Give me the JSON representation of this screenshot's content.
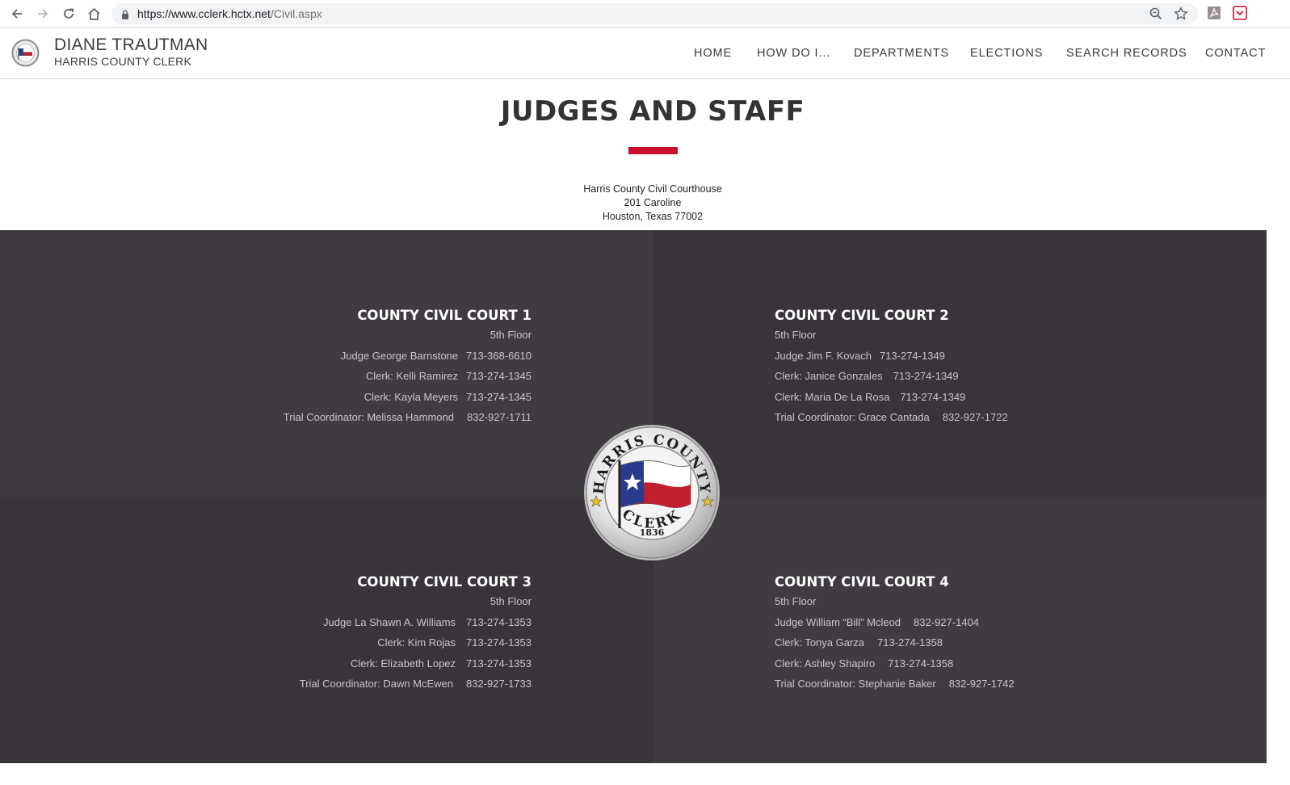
{
  "browser": {
    "url_host": "https://www.cclerk.hctx.net",
    "url_path": "/Civil.aspx"
  },
  "site": {
    "brand_name": "DIANE TRAUTMAN",
    "brand_sub": "HARRIS COUNTY CLERK",
    "nav": [
      "HOME",
      "HOW DO I...",
      "DEPARTMENTS",
      "ELECTIONS",
      "SEARCH RECORDS",
      "CONTACT US"
    ]
  },
  "page": {
    "title": "JUDGES AND STAFF",
    "address": [
      "Harris County Civil Courthouse",
      "201 Caroline",
      "Houston, Texas 77002"
    ],
    "accent_color": "#c8102e"
  },
  "courts": [
    {
      "name": "COUNTY CIVIL COURT 1",
      "floor": "5th Floor",
      "staff": [
        {
          "label": "Judge George Barnstone",
          "phone": "713-368-6610"
        },
        {
          "label": "Clerk: Kelli Ramirez",
          "phone": "713-274-1345"
        },
        {
          "label": "Clerk: Kayla Meyers",
          "phone": "713-274-1345"
        },
        {
          "label": "Trial Coordinator: Melissa Hammond",
          "phone": "832-927-1711"
        }
      ]
    },
    {
      "name": "COUNTY CIVIL COURT 2",
      "floor": "5th Floor",
      "staff": [
        {
          "label": "Judge Jim F. Kovach",
          "phone": "713-274-1349"
        },
        {
          "label": "Clerk: Janice Gonzales",
          "phone": "713-274-1349"
        },
        {
          "label": "Clerk: Maria De La Rosa",
          "phone": "713-274-1349"
        },
        {
          "label": "Trial Coordinator: Grace Cantada",
          "phone": "832-927-1722"
        }
      ]
    },
    {
      "name": "COUNTY CIVIL COURT 3",
      "floor": "5th Floor",
      "staff": [
        {
          "label": "Judge La Shawn A. Williams",
          "phone": "713-274-1353"
        },
        {
          "label": "Clerk: Kim Rojas",
          "phone": "713-274-1353"
        },
        {
          "label": "Clerk: Elizabeth Lopez",
          "phone": "713-274-1353"
        },
        {
          "label": "Trial Coordinator: Dawn McEwen",
          "phone": "832-927-1733"
        }
      ]
    },
    {
      "name": "COUNTY CIVIL COURT 4",
      "floor": "5th Floor",
      "staff": [
        {
          "label": "Judge William “Bill” Mcleod",
          "phone": "832-927-1404"
        },
        {
          "label": "Clerk: Tonya Garza",
          "phone": "713-274-1358"
        },
        {
          "label": "Clerk: Ashley Shapiro",
          "phone": "713-274-1358"
        },
        {
          "label": "Trial Coordinator: Stephanie Baker",
          "phone": "832-927-1742"
        }
      ]
    }
  ],
  "seal": {
    "top_text": "HARRIS COUNTY",
    "year": "1836",
    "bottom_text": "CLERK"
  }
}
